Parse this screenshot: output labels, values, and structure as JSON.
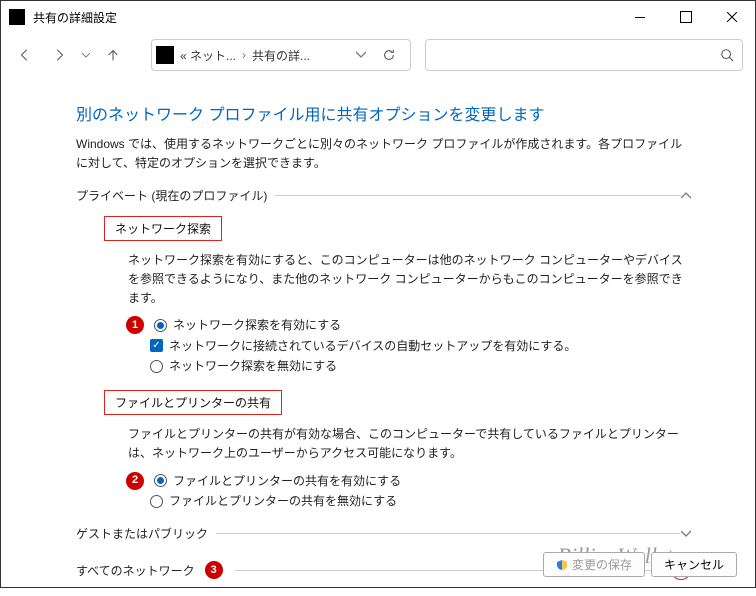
{
  "titlebar": {
    "title": "共有の詳細設定"
  },
  "breadcrumb": {
    "seg1": "« ネット...",
    "seg2": "共有の詳..."
  },
  "search": {
    "placeholder": ""
  },
  "heading": "別のネットワーク プロファイル用に共有オプションを変更します",
  "intro": "Windows では、使用するネットワークごとに別々のネットワーク プロファイルが作成されます。各プロファイルに対して、特定のオプションを選択できます。",
  "section_private": {
    "label": "プライベート (現在のプロファイル)"
  },
  "netdisc": {
    "box": "ネットワーク探索",
    "desc": "ネットワーク探索を有効にすると、このコンピューターは他のネットワーク コンピューターやデバイスを参照できるようになり、また他のネットワーク コンピューターからもこのコンピューターを参照できます。",
    "opt_on": "ネットワーク探索を有効にする",
    "opt_auto": "ネットワークに接続されているデバイスの自動セットアップを有効にする。",
    "opt_off": "ネットワーク探索を無効にする"
  },
  "fileprint": {
    "box": "ファイルとプリンターの共有",
    "desc": "ファイルとプリンターの共有が有効な場合、このコンピューターで共有しているファイルとプリンターは、ネットワーク上のユーザーからアクセス可能になります。",
    "opt_on": "ファイルとプリンターの共有を有効にする",
    "opt_off": "ファイルとプリンターの共有を無効にする"
  },
  "section_guest": {
    "label": "ゲストまたはパブリック"
  },
  "section_all": {
    "label": "すべてのネットワーク"
  },
  "markers": {
    "n1": "1",
    "n2": "2",
    "n3": "3"
  },
  "footer": {
    "save": "変更の保存",
    "cancel": "キャンセル"
  },
  "watermark": "BillionWallet.com"
}
